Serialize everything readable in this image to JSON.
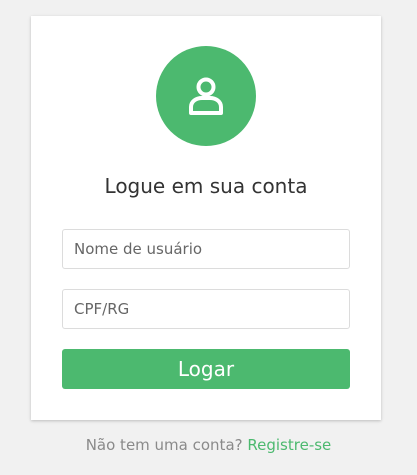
{
  "login": {
    "title": "Logue em sua conta",
    "username_placeholder": "Nome de usuário",
    "document_placeholder": "CPF/RG",
    "submit_label": "Logar"
  },
  "footer": {
    "prompt": "Não tem uma conta?",
    "register_link": "Registre-se"
  },
  "icons": {
    "avatar": "user-icon"
  },
  "colors": {
    "accent": "#4cb96f",
    "background": "#f1f1f1",
    "card": "#ffffff",
    "muted_text": "#8a8a8a"
  }
}
